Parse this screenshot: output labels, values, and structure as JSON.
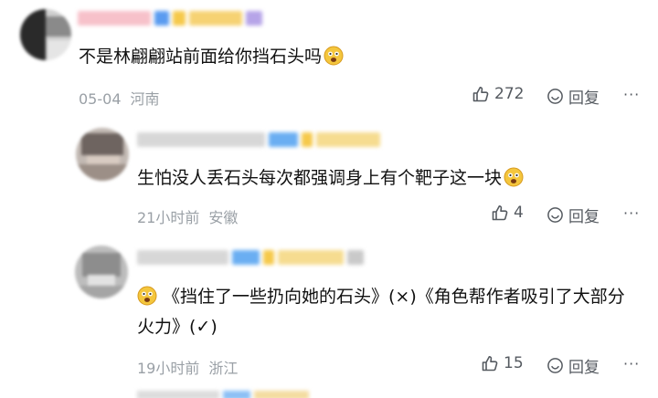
{
  "comments": [
    {
      "text": "不是林翩翩站前面给你挡石头吗",
      "date": "05-04",
      "location": "河南",
      "likes": "272",
      "reply_label": "回复",
      "more": "···"
    },
    {
      "text": "生怕没人丢石头每次都强调身上有个靶子这一块",
      "date": "21小时前",
      "location": "安徽",
      "likes": "4",
      "reply_label": "回复",
      "more": "···"
    },
    {
      "text_line1": "《挡住了一些扔向她的石头》(×)《角色帮作者吸引了大部分",
      "text_line2": "火力》(✓)",
      "date": "19小时前",
      "location": "浙江",
      "likes": "15",
      "reply_label": "回复",
      "more": "···"
    }
  ],
  "icons": {
    "like": "thumbs-up-icon",
    "reply": "reply-smile-icon",
    "emoji": "surprised-face-emoji"
  },
  "colors": {
    "text": "#111111",
    "meta": "#9aa0a6",
    "action": "#555a60",
    "emoji": "#f4c63d"
  }
}
